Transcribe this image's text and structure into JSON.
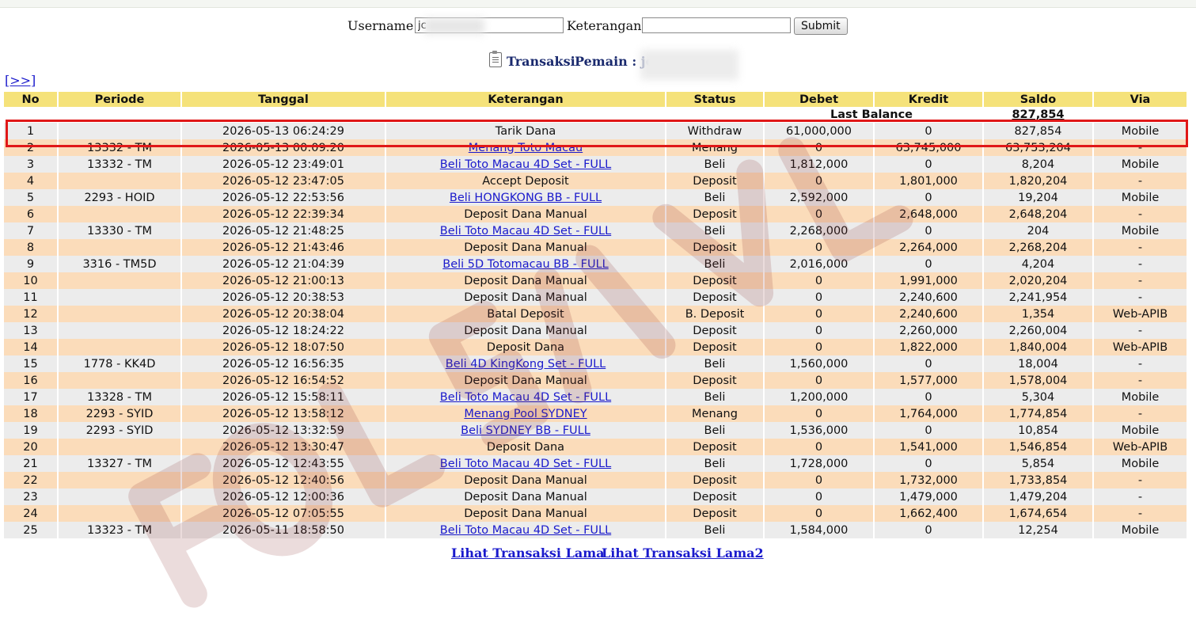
{
  "search": {
    "username_label": "Username :",
    "username_value": "jc",
    "keterangan_label": "Keterangan :",
    "keterangan_value": "",
    "submit_label": "Submit"
  },
  "heading": {
    "transaksi": "Transaksi",
    "pemain_label": "Pemain : jc"
  },
  "nav": {
    "next_label": "[>>]"
  },
  "table": {
    "headers": [
      "No",
      "Periode",
      "Tanggal",
      "Keterangan",
      "Status",
      "Debet",
      "Kredit",
      "Saldo",
      "Via"
    ],
    "last_balance_label": "Last Balance",
    "last_balance_value": "827,854",
    "rows": [
      {
        "no": "1",
        "periode": "",
        "tanggal": "2026-05-13 06:24:29",
        "keterangan": "Tarik Dana",
        "status": "Withdraw",
        "debet": "61,000,000",
        "kredit": "0",
        "saldo": "827,854",
        "via": "Mobile"
      },
      {
        "no": "2",
        "periode": "13332 - TM",
        "tanggal": "2026-05-13 00:09:20",
        "keterangan": "Menang Toto Macau",
        "status": "Menang",
        "debet": "0",
        "kredit": "63,745,000",
        "saldo": "63,753,204",
        "via": "-"
      },
      {
        "no": "3",
        "periode": "13332 - TM",
        "tanggal": "2026-05-12 23:49:01",
        "keterangan": "Beli Toto Macau 4D Set - FULL",
        "status": "Beli",
        "debet": "1,812,000",
        "kredit": "0",
        "saldo": "8,204",
        "via": "Mobile"
      },
      {
        "no": "4",
        "periode": "",
        "tanggal": "2026-05-12 23:47:05",
        "keterangan": "Accept Deposit",
        "status": "Deposit",
        "debet": "0",
        "kredit": "1,801,000",
        "saldo": "1,820,204",
        "via": "-"
      },
      {
        "no": "5",
        "periode": "2293 - HOID",
        "tanggal": "2026-05-12 22:53:56",
        "keterangan": "Beli HONGKONG BB - FULL",
        "status": "Beli",
        "debet": "2,592,000",
        "kredit": "0",
        "saldo": "19,204",
        "via": "Mobile"
      },
      {
        "no": "6",
        "periode": "",
        "tanggal": "2026-05-12 22:39:34",
        "keterangan": "Deposit Dana Manual",
        "status": "Deposit",
        "debet": "0",
        "kredit": "2,648,000",
        "saldo": "2,648,204",
        "via": "-"
      },
      {
        "no": "7",
        "periode": "13330 - TM",
        "tanggal": "2026-05-12 21:48:25",
        "keterangan": "Beli Toto Macau 4D Set - FULL",
        "status": "Beli",
        "debet": "2,268,000",
        "kredit": "0",
        "saldo": "204",
        "via": "Mobile"
      },
      {
        "no": "8",
        "periode": "",
        "tanggal": "2026-05-12 21:43:46",
        "keterangan": "Deposit Dana Manual",
        "status": "Deposit",
        "debet": "0",
        "kredit": "2,264,000",
        "saldo": "2,268,204",
        "via": "-"
      },
      {
        "no": "9",
        "periode": "3316 - TM5D",
        "tanggal": "2026-05-12 21:04:39",
        "keterangan": "Beli 5D Totomacau BB - FULL",
        "status": "Beli",
        "debet": "2,016,000",
        "kredit": "0",
        "saldo": "4,204",
        "via": "-"
      },
      {
        "no": "10",
        "periode": "",
        "tanggal": "2026-05-12 21:00:13",
        "keterangan": "Deposit Dana Manual",
        "status": "Deposit",
        "debet": "0",
        "kredit": "1,991,000",
        "saldo": "2,020,204",
        "via": "-"
      },
      {
        "no": "11",
        "periode": "",
        "tanggal": "2026-05-12 20:38:53",
        "keterangan": "Deposit Dana Manual",
        "status": "Deposit",
        "debet": "0",
        "kredit": "2,240,600",
        "saldo": "2,241,954",
        "via": "-"
      },
      {
        "no": "12",
        "periode": "",
        "tanggal": "2026-05-12 20:38:04",
        "keterangan": "Batal Deposit",
        "status": "B. Deposit",
        "debet": "0",
        "kredit": "2,240,600",
        "saldo": "1,354",
        "via": "Web-APIB"
      },
      {
        "no": "13",
        "periode": "",
        "tanggal": "2026-05-12 18:24:22",
        "keterangan": "Deposit Dana Manual",
        "status": "Deposit",
        "debet": "0",
        "kredit": "2,260,000",
        "saldo": "2,260,004",
        "via": "-"
      },
      {
        "no": "14",
        "periode": "",
        "tanggal": "2026-05-12 18:07:50",
        "keterangan": "Deposit Dana",
        "status": "Deposit",
        "debet": "0",
        "kredit": "1,822,000",
        "saldo": "1,840,004",
        "via": "Web-APIB"
      },
      {
        "no": "15",
        "periode": "1778 - KK4D",
        "tanggal": "2026-05-12 16:56:35",
        "keterangan": "Beli 4D KingKong Set - FULL",
        "status": "Beli",
        "debet": "1,560,000",
        "kredit": "0",
        "saldo": "18,004",
        "via": "-"
      },
      {
        "no": "16",
        "periode": "",
        "tanggal": "2026-05-12 16:54:52",
        "keterangan": "Deposit Dana Manual",
        "status": "Deposit",
        "debet": "0",
        "kredit": "1,577,000",
        "saldo": "1,578,004",
        "via": "-"
      },
      {
        "no": "17",
        "periode": "13328 - TM",
        "tanggal": "2026-05-12 15:58:11",
        "keterangan": "Beli Toto Macau 4D Set - FULL",
        "status": "Beli",
        "debet": "1,200,000",
        "kredit": "0",
        "saldo": "5,304",
        "via": "Mobile"
      },
      {
        "no": "18",
        "periode": "2293 - SYID",
        "tanggal": "2026-05-12 13:58:12",
        "keterangan": "Menang Pool SYDNEY",
        "status": "Menang",
        "debet": "0",
        "kredit": "1,764,000",
        "saldo": "1,774,854",
        "via": "-"
      },
      {
        "no": "19",
        "periode": "2293 - SYID",
        "tanggal": "2026-05-12 13:32:59",
        "keterangan": "Beli SYDNEY BB - FULL",
        "status": "Beli",
        "debet": "1,536,000",
        "kredit": "0",
        "saldo": "10,854",
        "via": "Mobile"
      },
      {
        "no": "20",
        "periode": "",
        "tanggal": "2026-05-12 13:30:47",
        "keterangan": "Deposit Dana",
        "status": "Deposit",
        "debet": "0",
        "kredit": "1,541,000",
        "saldo": "1,546,854",
        "via": "Web-APIB"
      },
      {
        "no": "21",
        "periode": "13327 - TM",
        "tanggal": "2026-05-12 12:43:55",
        "keterangan": "Beli Toto Macau 4D Set - FULL",
        "status": "Beli",
        "debet": "1,728,000",
        "kredit": "0",
        "saldo": "5,854",
        "via": "Mobile"
      },
      {
        "no": "22",
        "periode": "",
        "tanggal": "2026-05-12 12:40:56",
        "keterangan": "Deposit Dana Manual",
        "status": "Deposit",
        "debet": "0",
        "kredit": "1,732,000",
        "saldo": "1,733,854",
        "via": "-"
      },
      {
        "no": "23",
        "periode": "",
        "tanggal": "2026-05-12 12:00:36",
        "keterangan": "Deposit Dana Manual",
        "status": "Deposit",
        "debet": "0",
        "kredit": "1,479,000",
        "saldo": "1,479,204",
        "via": "-"
      },
      {
        "no": "24",
        "periode": "",
        "tanggal": "2026-05-12 07:05:55",
        "keterangan": "Deposit Dana Manual",
        "status": "Deposit",
        "debet": "0",
        "kredit": "1,662,400",
        "saldo": "1,674,654",
        "via": "-"
      },
      {
        "no": "25",
        "periode": "13323 - TM",
        "tanggal": "2026-05-11 18:58:50",
        "keterangan": "Beli Toto Macau 4D Set - FULL",
        "status": "Beli",
        "debet": "1,584,000",
        "kredit": "0",
        "saldo": "12,254",
        "via": "Mobile"
      }
    ]
  },
  "footer": {
    "link1": "Lihat Transaksi Lama",
    "link2": "Lihat Transaksi Lama2"
  },
  "colors": {
    "header_bg": "#f5e27a",
    "row_odd": "#ececec",
    "row_even": "#fbdcba",
    "status_red": "#cc2222",
    "link_blue": "#1a1acc",
    "highlight_red": "#e01818"
  }
}
